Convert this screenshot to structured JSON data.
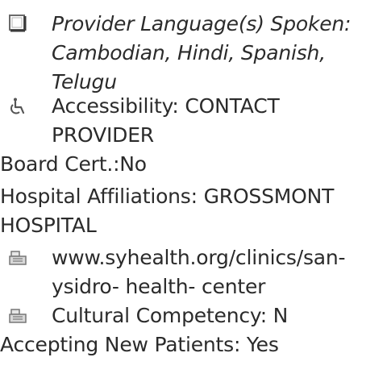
{
  "provider": {
    "languages_text": "Provider Language(s) Spoken: Cambodian, Hindi, Spanish, Telugu",
    "accessibility_text": "Accessibility: CONTACT PROVIDER",
    "board_cert_text": "Board Cert.:No",
    "hospital_text": "Hospital Affiliations: GROSSMONT HOSPITAL",
    "website_text": "www.syhealth.org/clinics/san-ysidro- health- center",
    "cultural_text": "Cultural Competency: N",
    "accepting_text": "Accepting New Patients: Yes"
  },
  "icons": {
    "languages": "checkbox-icon",
    "accessibility": "wheelchair-icon",
    "website": "fax-icon",
    "cultural": "fax-icon"
  }
}
